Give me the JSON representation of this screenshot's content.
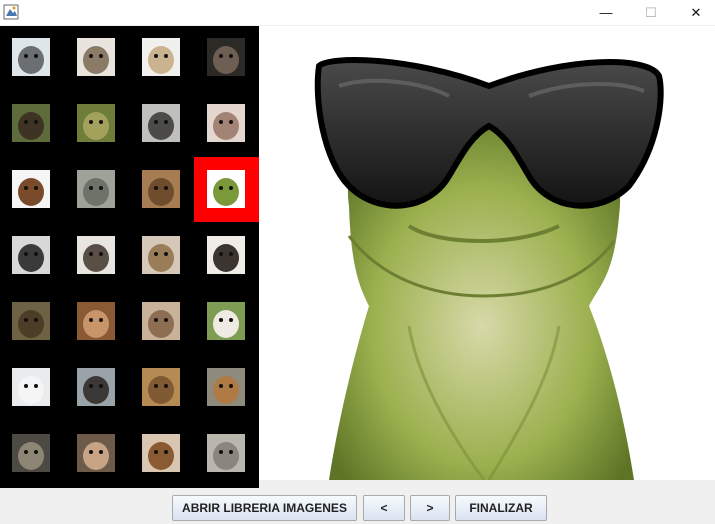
{
  "window": {
    "app_icon": "java-cup-icon",
    "minimize_icon": "minimize-icon",
    "maximize_icon": "maximize-icon",
    "close_icon": "close-icon",
    "minimize_glyph": "—",
    "maximize_glyph": "☐",
    "close_glyph": "✕"
  },
  "gallery": {
    "selected_index": 11,
    "selection_color": "#ff0000",
    "thumbnails": [
      {
        "subject": "husky with glasses",
        "bg": "#dfe6e9",
        "fg": "#6b6f72"
      },
      {
        "subject": "dog",
        "bg": "#e9e4de",
        "fg": "#8a7a66"
      },
      {
        "subject": "dog with glasses",
        "bg": "#f2f0ec",
        "fg": "#c9b48f"
      },
      {
        "subject": "dark animal",
        "bg": "#2c2a27",
        "fg": "#6e5f52"
      },
      {
        "subject": "chimpanzee",
        "bg": "#5e6b3a",
        "fg": "#3f3424"
      },
      {
        "subject": "green creature",
        "bg": "#6f7d3b",
        "fg": "#a3a25c"
      },
      {
        "subject": "monkey",
        "bg": "#bfc0bb",
        "fg": "#4d4b47"
      },
      {
        "subject": "monkey face",
        "bg": "#e4d7cf",
        "fg": "#a38375"
      },
      {
        "subject": "dancing animal",
        "bg": "#f5f5f5",
        "fg": "#7a4b2b"
      },
      {
        "subject": "cat",
        "bg": "#9ea39a",
        "fg": "#6e736a"
      },
      {
        "subject": "squirrel",
        "bg": "#a67d52",
        "fg": "#6f4d2c"
      },
      {
        "subject": "frog with sunglasses",
        "bg": "#ffffff",
        "fg": "#7a9a3a"
      },
      {
        "subject": "raccoon",
        "bg": "#d8d8d8",
        "fg": "#3a3a3a"
      },
      {
        "subject": "pug",
        "bg": "#e8e4e0",
        "fg": "#5a4f47"
      },
      {
        "subject": "cat",
        "bg": "#d5c8b8",
        "fg": "#9b7c58"
      },
      {
        "subject": "pug puppy",
        "bg": "#f0ede9",
        "fg": "#3b342f"
      },
      {
        "subject": "monkey",
        "bg": "#6e6244",
        "fg": "#4c3d26"
      },
      {
        "subject": "monkey face",
        "bg": "#8a5a34",
        "fg": "#c8946a"
      },
      {
        "subject": "hamster",
        "bg": "#c9b29a",
        "fg": "#8e6e52"
      },
      {
        "subject": "dog tongue",
        "bg": "#7f9c55",
        "fg": "#efeae2"
      },
      {
        "subject": "white dog",
        "bg": "#e9ecef",
        "fg": "#f5f5f5"
      },
      {
        "subject": "dog",
        "bg": "#9aa3a8",
        "fg": "#3c3835"
      },
      {
        "subject": "puppy",
        "bg": "#b68a53",
        "fg": "#7f5a32"
      },
      {
        "subject": "squirrel",
        "bg": "#8e8a7c",
        "fg": "#b07a45"
      },
      {
        "subject": "animals",
        "bg": "#4d4a44",
        "fg": "#8e8675"
      },
      {
        "subject": "dog",
        "bg": "#6e5a48",
        "fg": "#c7a486"
      },
      {
        "subject": "horse",
        "bg": "#d8c6b3",
        "fg": "#8a5a33"
      },
      {
        "subject": "elephant",
        "bg": "#b9b6ae",
        "fg": "#8a857d"
      }
    ]
  },
  "viewer": {
    "subject": "frog with sunglasses",
    "frog_color": "#8fa84a",
    "glasses_color": "#1a1a1a"
  },
  "buttons": {
    "open_library": "ABRIR LIBRERIA IMAGENES",
    "prev": "<",
    "next": ">",
    "finish": "FINALIZAR"
  }
}
